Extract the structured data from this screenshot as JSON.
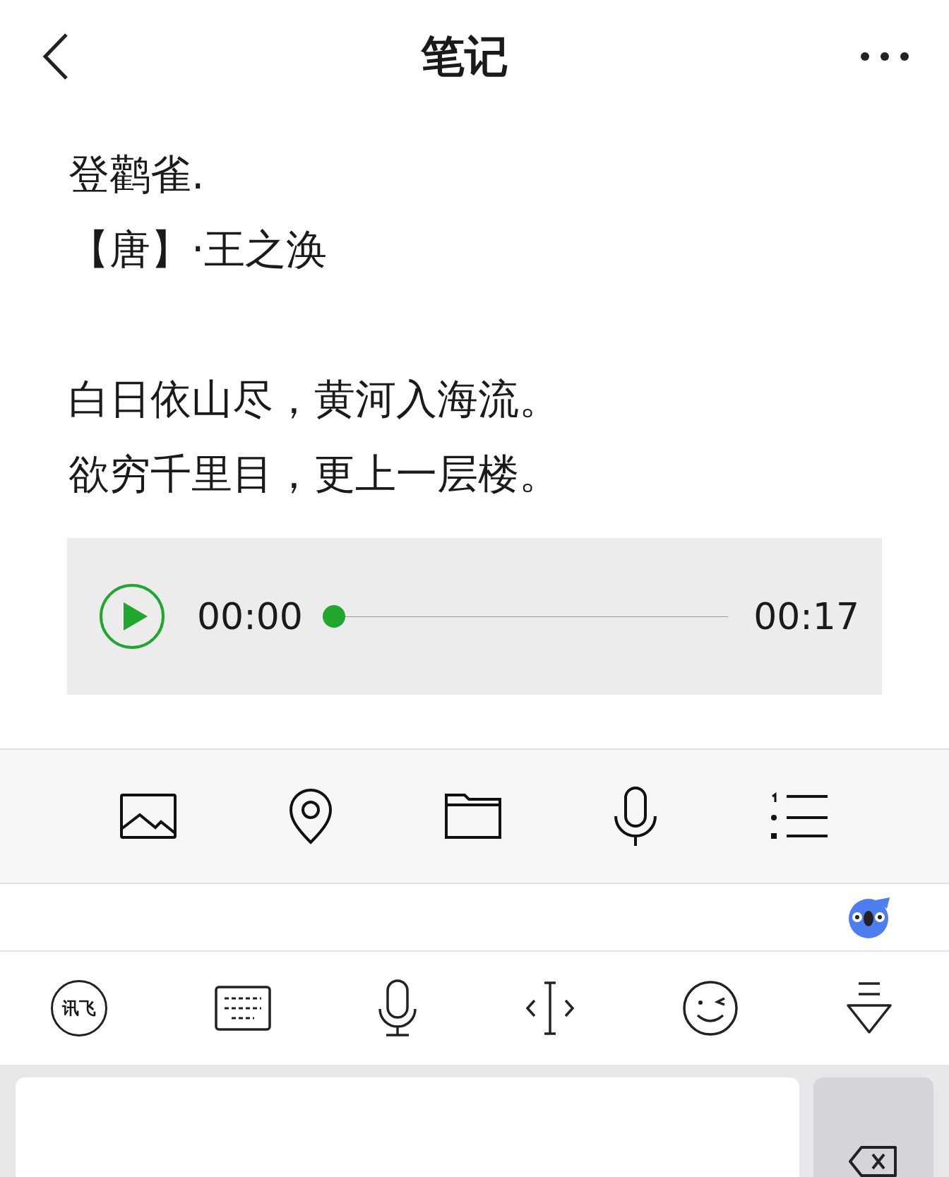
{
  "header": {
    "title": "笔记"
  },
  "note": {
    "heading": [
      "登鹳雀.",
      "【唐】·王之涣"
    ],
    "verses": [
      "白日依山尽，黄河入海流。",
      "欲穷千里目，更上一层楼。"
    ]
  },
  "audio": {
    "elapsed": "00:00",
    "duration": "00:17",
    "level": 0
  },
  "toolbar": [
    {
      "kind": "image"
    },
    {
      "kind": "location"
    },
    {
      "kind": "folder"
    },
    {
      "kind": "mic"
    },
    {
      "kind": "list"
    }
  ],
  "keyboard": {
    "logo": "讯飞",
    "tools": [
      {
        "kind": "keyboard"
      },
      {
        "kind": "mic"
      },
      {
        "kind": "cursor"
      },
      {
        "kind": "emoji"
      },
      {
        "kind": "hide"
      }
    ]
  }
}
